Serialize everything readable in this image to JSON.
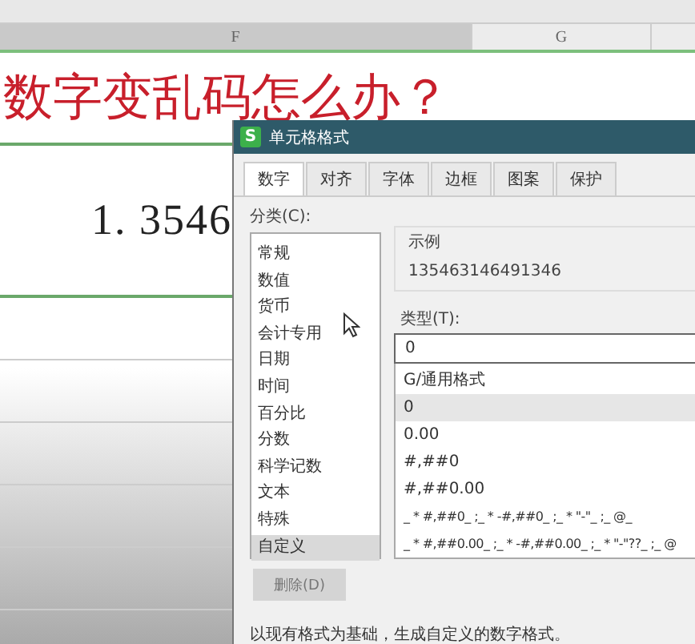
{
  "sheet": {
    "columns": [
      {
        "label": "F",
        "selected": true
      },
      {
        "label": "G",
        "selected": false
      }
    ],
    "title_cell": "数字变乱码怎么办？",
    "value_cell": "1. 3546"
  },
  "dialog": {
    "title": "单元格格式",
    "app_icon": "S",
    "tabs": [
      {
        "label": "数字",
        "selected": true
      },
      {
        "label": "对齐",
        "selected": false
      },
      {
        "label": "字体",
        "selected": false
      },
      {
        "label": "边框",
        "selected": false
      },
      {
        "label": "图案",
        "selected": false
      },
      {
        "label": "保护",
        "selected": false
      }
    ],
    "category_label": "分类(C):",
    "categories": [
      {
        "label": "常规",
        "selected": false
      },
      {
        "label": "数值",
        "selected": false
      },
      {
        "label": "货币",
        "selected": false
      },
      {
        "label": "会计专用",
        "selected": false
      },
      {
        "label": "日期",
        "selected": false
      },
      {
        "label": "时间",
        "selected": false
      },
      {
        "label": "百分比",
        "selected": false
      },
      {
        "label": "分数",
        "selected": false
      },
      {
        "label": "科学记数",
        "selected": false
      },
      {
        "label": "文本",
        "selected": false
      },
      {
        "label": "特殊",
        "selected": false
      },
      {
        "label": "自定义",
        "selected": true
      }
    ],
    "sample_label": "示例",
    "sample_value": "135463146491346",
    "type_label": "类型(T):",
    "type_value": "0",
    "formats": [
      {
        "label": "G/通用格式",
        "selected": false
      },
      {
        "label": "0",
        "selected": true
      },
      {
        "label": "0.00",
        "selected": false
      },
      {
        "label": "#,##0",
        "selected": false
      },
      {
        "label": "#,##0.00",
        "selected": false
      },
      {
        "label": "_ * #,##0_ ;_ * -#,##0_ ;_ * \"-\"_ ;_ @_",
        "selected": false
      },
      {
        "label": "_ * #,##0.00_ ;_ * -#,##0.00_ ;_ * \"-\"??_ ;_ @",
        "selected": false
      }
    ],
    "delete_button": {
      "label": "删除(D)",
      "disabled": true
    },
    "hint": "以现有格式为基础，生成自定义的数字格式。"
  }
}
